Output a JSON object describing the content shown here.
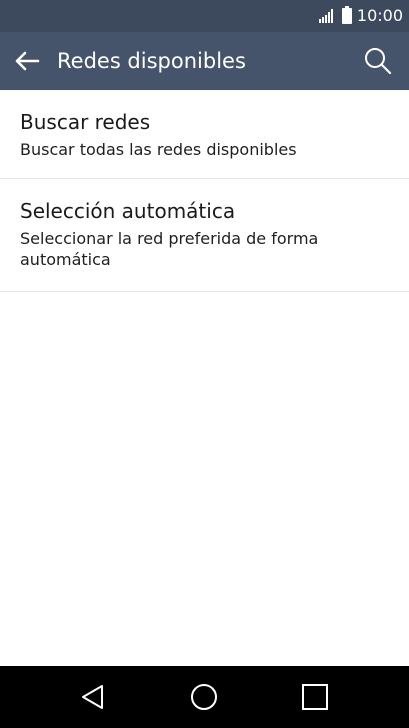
{
  "status_bar": {
    "time": "10:00",
    "icons": [
      "signal-icon",
      "battery-icon"
    ]
  },
  "app_bar": {
    "title": "Redes disponibles",
    "icons": [
      "back-arrow-icon",
      "search-icon"
    ]
  },
  "list": {
    "items": [
      {
        "title": "Buscar redes",
        "summary": "Buscar todas las redes disponibles"
      },
      {
        "title": "Selección automática",
        "summary": "Seleccionar la red preferida de forma automática"
      }
    ]
  },
  "nav_bar": {
    "icons": [
      "nav-back-icon",
      "nav-home-icon",
      "nav-recents-icon"
    ]
  },
  "colors": {
    "status_bar": "#3d4a5d",
    "app_bar": "#45536b",
    "nav_bar": "#000000",
    "background": "#ffffff",
    "divider": "#e6e6e6"
  }
}
